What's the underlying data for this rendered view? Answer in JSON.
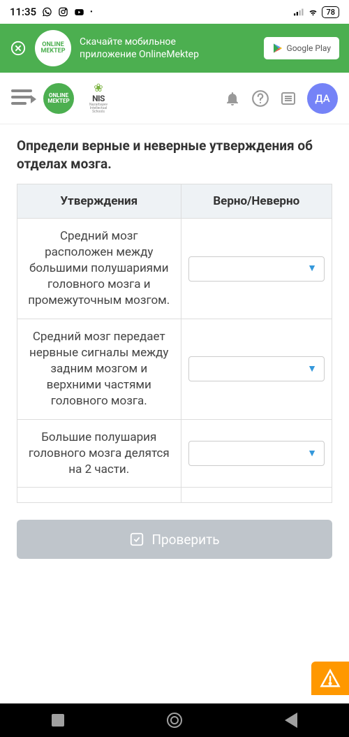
{
  "status_bar": {
    "time": "11:35",
    "battery": "78"
  },
  "promo": {
    "logo_line1": "ONLINE",
    "logo_line2": "MEKTEP",
    "text_line1": "Скачайте мобильное",
    "text_line2": "приложение OnlineMektep",
    "button_label": "Google Play"
  },
  "header": {
    "logo_line1": "ONLINE",
    "logo_line2": "MEKTEP",
    "nis_label": "NIS",
    "nis_sub": "Nazarbayev Intellectual Schools",
    "avatar": "ДА"
  },
  "question": {
    "title": "Определи верные и неверные утверждения об отделах мозга.",
    "col1": "Утверждения",
    "col2": "Верно/Неверно",
    "rows": [
      "Средний мозг расположен между большими полушариями головного мозга и промежуточным мозгом.",
      "Средний мозг передает нервные сигналы между задним мозгом и верхними частями головного мозга.",
      "Большие полушария головного мозга делятся на 2 части."
    ]
  },
  "check_button": "Проверить"
}
